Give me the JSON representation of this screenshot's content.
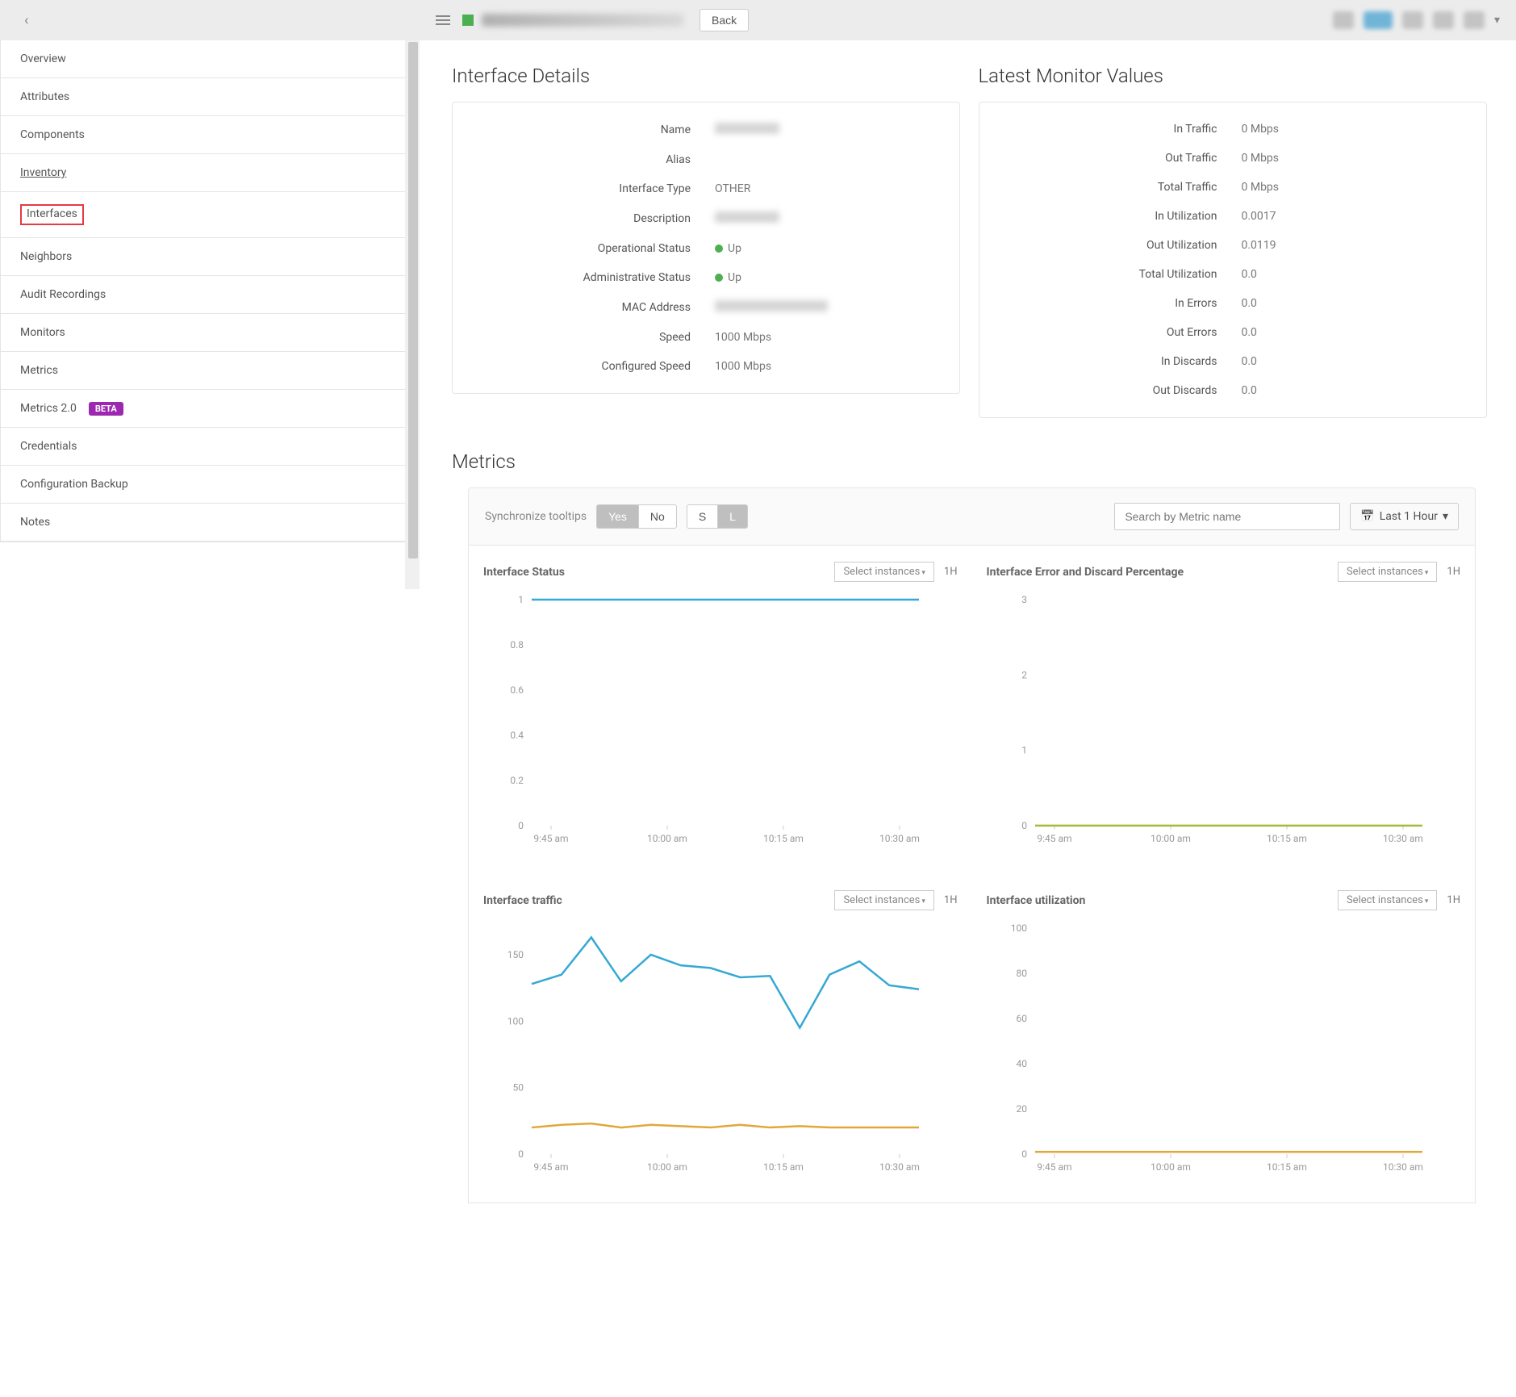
{
  "header": {
    "back_arrow": "‹",
    "back_button": "Back",
    "timerange_label": "Last 1 Hour",
    "caret": "▾"
  },
  "sidebar": {
    "items": [
      {
        "label": "Overview"
      },
      {
        "label": "Attributes"
      },
      {
        "label": "Components"
      },
      {
        "label": "Inventory"
      },
      {
        "label": "Interfaces"
      },
      {
        "label": "Neighbors"
      },
      {
        "label": "Audit Recordings"
      },
      {
        "label": "Monitors"
      },
      {
        "label": "Metrics"
      },
      {
        "label": "Metrics 2.0",
        "beta": "BETA"
      },
      {
        "label": "Credentials"
      },
      {
        "label": "Configuration Backup"
      },
      {
        "label": "Notes"
      }
    ]
  },
  "sections": {
    "interface_details_title": "Interface Details",
    "latest_monitor_title": "Latest Monitor Values",
    "metrics_title": "Metrics"
  },
  "details": {
    "rows": [
      {
        "label": "Name",
        "value_blur": true
      },
      {
        "label": "Alias",
        "value": ""
      },
      {
        "label": "Interface Type",
        "value": "OTHER"
      },
      {
        "label": "Description",
        "value_blur": true
      },
      {
        "label": "Operational Status",
        "value": "Up",
        "status": true
      },
      {
        "label": "Administrative Status",
        "value": "Up",
        "status": true
      },
      {
        "label": "MAC Address",
        "value_blur": true,
        "wide": true
      },
      {
        "label": "Speed",
        "value": "1000 Mbps"
      },
      {
        "label": "Configured Speed",
        "value": "1000 Mbps"
      }
    ]
  },
  "monitor": {
    "rows": [
      {
        "label": "In Traffic",
        "value": "0 Mbps"
      },
      {
        "label": "Out Traffic",
        "value": "0 Mbps"
      },
      {
        "label": "Total Traffic",
        "value": "0 Mbps"
      },
      {
        "label": "In Utilization",
        "value": "0.0017"
      },
      {
        "label": "Out Utilization",
        "value": "0.0119"
      },
      {
        "label": "Total Utilization",
        "value": "0.0"
      },
      {
        "label": "In Errors",
        "value": "0.0"
      },
      {
        "label": "Out Errors",
        "value": "0.0"
      },
      {
        "label": "In Discards",
        "value": "0.0"
      },
      {
        "label": "Out Discards",
        "value": "0.0"
      }
    ]
  },
  "toolbar": {
    "sync_label": "Synchronize tooltips",
    "yes": "Yes",
    "no": "No",
    "s": "S",
    "l": "L",
    "search_placeholder": "Search by Metric name"
  },
  "charts_meta": {
    "select_instances": "Select instances",
    "range_tag": "1H",
    "titles": {
      "status": "Interface Status",
      "error": "Interface Error and Discard Percentage",
      "traffic": "Interface traffic",
      "util": "Interface utilization"
    }
  },
  "chart_data": [
    {
      "type": "line",
      "title": "Interface Status",
      "x": [
        "9:45 am",
        "10:00 am",
        "10:15 am",
        "10:30 am"
      ],
      "ylim": [
        0,
        1
      ],
      "yticks": [
        0,
        0.2,
        0.4,
        0.6,
        0.8,
        1
      ],
      "series": [
        {
          "name": "status",
          "color": "#35a8d4",
          "values": [
            1,
            1,
            1,
            1,
            1,
            1,
            1,
            1,
            1,
            1,
            1,
            1
          ]
        }
      ]
    },
    {
      "type": "line",
      "title": "Interface Error and Discard Percentage",
      "x": [
        "9:45 am",
        "10:00 am",
        "10:15 am",
        "10:30 am"
      ],
      "ylim": [
        0,
        3
      ],
      "yticks": [
        0,
        1,
        2,
        3
      ],
      "series": [
        {
          "name": "error",
          "color": "#a4b83a",
          "values": [
            0,
            0,
            0,
            0,
            0,
            0,
            0,
            0,
            0,
            0,
            0,
            0
          ]
        }
      ]
    },
    {
      "type": "line",
      "title": "Interface traffic",
      "x": [
        "9:45 am",
        "10:00 am",
        "10:15 am",
        "10:30 am"
      ],
      "ylim": [
        0,
        170
      ],
      "yticks": [
        0,
        50,
        100,
        150
      ],
      "series": [
        {
          "name": "in",
          "color": "#35a8d4",
          "values": [
            128,
            135,
            163,
            130,
            150,
            142,
            140,
            133,
            134,
            95,
            135,
            145,
            127,
            124
          ]
        },
        {
          "name": "out",
          "color": "#e0a83a",
          "values": [
            20,
            22,
            23,
            20,
            22,
            21,
            20,
            22,
            20,
            21,
            20,
            20,
            20,
            20
          ]
        }
      ]
    },
    {
      "type": "line",
      "title": "Interface utilization",
      "x": [
        "9:45 am",
        "10:00 am",
        "10:15 am",
        "10:30 am"
      ],
      "ylim": [
        0,
        100
      ],
      "yticks": [
        0,
        20,
        40,
        60,
        80,
        100
      ],
      "series": [
        {
          "name": "util",
          "color": "#e0a83a",
          "values": [
            1,
            1,
            1,
            1,
            1,
            1,
            1,
            1,
            1,
            1,
            1,
            1
          ]
        }
      ]
    }
  ]
}
